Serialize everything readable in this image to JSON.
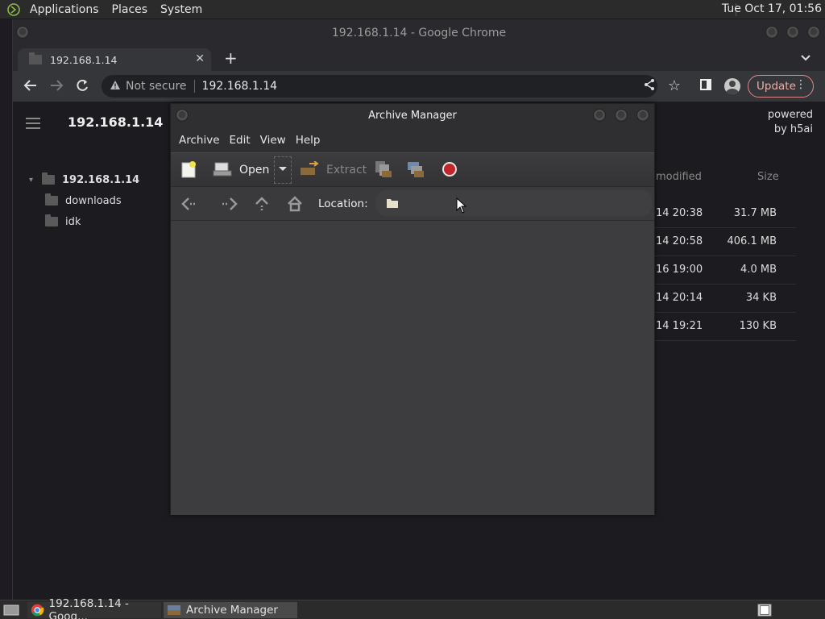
{
  "top_panel": {
    "menus": [
      "Applications",
      "Places",
      "System"
    ],
    "clock": "Tue Oct 17, 01:56"
  },
  "chrome": {
    "window_title": "192.168.1.14 - Google Chrome",
    "tab_title": "192.168.1.14",
    "security_label": "Not secure",
    "url": "192.168.1.14",
    "update_label": "Update"
  },
  "h5ai": {
    "site_title": "192.168.1.14",
    "powered_line1": "powered",
    "powered_line2": "by h5ai",
    "tree_root": "192.168.1.14",
    "tree_items": [
      "downloads",
      "idk"
    ],
    "col_modified": "modified",
    "col_size": "Size",
    "files": [
      {
        "date": "14 20:38",
        "size": "31.7 MB"
      },
      {
        "date": "14 20:58",
        "size": "406.1 MB"
      },
      {
        "date": "16 19:00",
        "size": "4.0 MB"
      },
      {
        "date": "14 20:14",
        "size": "34 KB"
      },
      {
        "date": "14 19:21",
        "size": "130 KB"
      }
    ]
  },
  "archive_manager": {
    "title": "Archive Manager",
    "menus": [
      "Archive",
      "Edit",
      "View",
      "Help"
    ],
    "open_label": "Open",
    "extract_label": "Extract",
    "location_label": "Location:"
  },
  "taskbar": {
    "tasks": [
      "192.168.1.14 - Goog...",
      "Archive Manager"
    ]
  },
  "colors": {
    "stop_red": "#c0262c",
    "update_border": "#dd8888"
  }
}
